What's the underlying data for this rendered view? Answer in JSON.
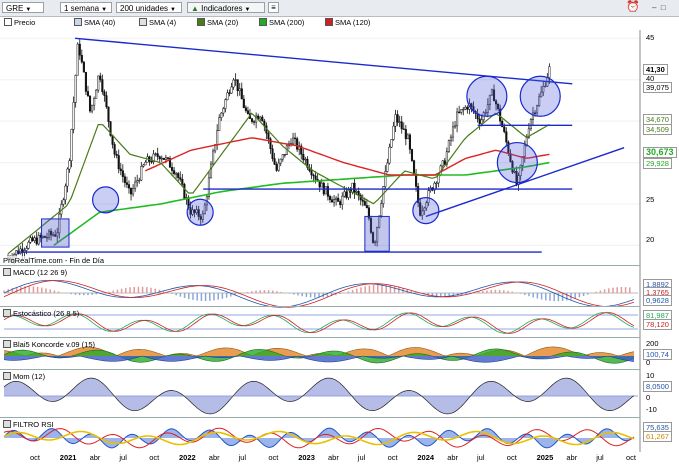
{
  "toolbar": {
    "ticker": "GRE",
    "period": "1 semana",
    "units": "200 unidades",
    "indicators_label": "Indicadores"
  },
  "legend": [
    {
      "label": "Precio",
      "color": "#ffffff"
    },
    {
      "label": "SMA (40)",
      "color": "#c8d8e8"
    },
    {
      "label": "SMA (4)",
      "color": "#e0e0e0"
    },
    {
      "label": "SMA (20)",
      "color": "#4a7a1a"
    },
    {
      "label": "SMA (200)",
      "color": "#22aa22"
    },
    {
      "label": "SMA (120)",
      "color": "#cc2222"
    }
  ],
  "watermark": "ProRealTime.com - Fin de Día",
  "price_axis": {
    "ticks": [
      "45",
      "40",
      "35",
      "30",
      "25",
      "20"
    ],
    "value_boxes": [
      {
        "label": "41,30",
        "color": "#000000"
      },
      {
        "label": "39,075",
        "color": "#000000"
      },
      {
        "label": "34,670",
        "color": "#4a7a1a"
      },
      {
        "label": "34,509",
        "color": "#4a7a1a"
      },
      {
        "label": "30,673",
        "color": "#22aa22"
      },
      {
        "label": "29,928",
        "color": "#22aa22"
      }
    ]
  },
  "panels": {
    "macd": {
      "title": "MACD (12 26 9)",
      "values": [
        "1,8892",
        "1,3765",
        "0,9628"
      ]
    },
    "stoch": {
      "title": "Estocástico (26 8 5)",
      "values": [
        "81,987",
        "78,120"
      ]
    },
    "koncorde": {
      "title": "Blai5 Koncorde v.09 (15)",
      "ticks": [
        "200",
        "100",
        "0"
      ],
      "values": [
        "100,74"
      ]
    },
    "mom": {
      "title": "Mom (12)",
      "ticks": [
        "10",
        "0",
        "-10"
      ],
      "values": [
        "8,0500"
      ]
    },
    "rsi": {
      "title": "FILTRO RSI",
      "values": [
        "75,635",
        "61,267"
      ]
    }
  },
  "x_axis": [
    {
      "label": "oct",
      "year": false
    },
    {
      "label": "2021",
      "year": true
    },
    {
      "label": "abr",
      "year": false
    },
    {
      "label": "jul",
      "year": false
    },
    {
      "label": "oct",
      "year": false
    },
    {
      "label": "2022",
      "year": true
    },
    {
      "label": "abr",
      "year": false
    },
    {
      "label": "jul",
      "year": false
    },
    {
      "label": "oct",
      "year": false
    },
    {
      "label": "2023",
      "year": true
    },
    {
      "label": "abr",
      "year": false
    },
    {
      "label": "jul",
      "year": false
    },
    {
      "label": "oct",
      "year": false
    },
    {
      "label": "2024",
      "year": true
    },
    {
      "label": "abr",
      "year": false
    },
    {
      "label": "jul",
      "year": false
    },
    {
      "label": "oct",
      "year": false
    },
    {
      "label": "2025",
      "year": true
    },
    {
      "label": "abr",
      "year": false
    },
    {
      "label": "jul",
      "year": false
    },
    {
      "label": "oct",
      "year": false
    }
  ],
  "chart_data": {
    "type": "line",
    "title": "",
    "ylim": [
      18,
      46
    ],
    "price_anchors": [
      {
        "x": 0.0,
        "y": 18.5
      },
      {
        "x": 0.8,
        "y": 20.5
      },
      {
        "x": 1.6,
        "y": 21.5
      },
      {
        "x": 2.0,
        "y": 30
      },
      {
        "x": 2.3,
        "y": 44.5
      },
      {
        "x": 2.7,
        "y": 36
      },
      {
        "x": 3.0,
        "y": 41
      },
      {
        "x": 3.5,
        "y": 31
      },
      {
        "x": 4.0,
        "y": 26
      },
      {
        "x": 4.5,
        "y": 30
      },
      {
        "x": 5.0,
        "y": 31
      },
      {
        "x": 5.5,
        "y": 29
      },
      {
        "x": 6.0,
        "y": 24
      },
      {
        "x": 6.4,
        "y": 23.5
      },
      {
        "x": 6.9,
        "y": 35
      },
      {
        "x": 7.4,
        "y": 40.5
      },
      {
        "x": 7.9,
        "y": 35
      },
      {
        "x": 8.3,
        "y": 36
      },
      {
        "x": 8.8,
        "y": 29
      },
      {
        "x": 9.3,
        "y": 33
      },
      {
        "x": 9.8,
        "y": 30
      },
      {
        "x": 10.3,
        "y": 27
      },
      {
        "x": 10.8,
        "y": 25
      },
      {
        "x": 11.3,
        "y": 27
      },
      {
        "x": 11.8,
        "y": 24
      },
      {
        "x": 12.0,
        "y": 20
      },
      {
        "x": 12.3,
        "y": 27
      },
      {
        "x": 12.7,
        "y": 35.5
      },
      {
        "x": 13.1,
        "y": 33
      },
      {
        "x": 13.5,
        "y": 24
      },
      {
        "x": 13.9,
        "y": 27
      },
      {
        "x": 14.3,
        "y": 30
      },
      {
        "x": 14.7,
        "y": 35.5
      },
      {
        "x": 15.1,
        "y": 37
      },
      {
        "x": 15.5,
        "y": 35
      },
      {
        "x": 15.9,
        "y": 38.5
      },
      {
        "x": 16.3,
        "y": 33
      },
      {
        "x": 16.7,
        "y": 27
      },
      {
        "x": 17.1,
        "y": 35
      },
      {
        "x": 17.5,
        "y": 38.5
      },
      {
        "x": 17.75,
        "y": 41.3
      }
    ],
    "sma20_anchors": [
      {
        "x": 0,
        "y": 19
      },
      {
        "x": 2,
        "y": 25
      },
      {
        "x": 3,
        "y": 35
      },
      {
        "x": 4,
        "y": 31
      },
      {
        "x": 5,
        "y": 30
      },
      {
        "x": 6,
        "y": 26
      },
      {
        "x": 7,
        "y": 31
      },
      {
        "x": 8,
        "y": 36
      },
      {
        "x": 9,
        "y": 32
      },
      {
        "x": 10,
        "y": 29
      },
      {
        "x": 11,
        "y": 27
      },
      {
        "x": 12,
        "y": 25
      },
      {
        "x": 13,
        "y": 29
      },
      {
        "x": 14,
        "y": 28
      },
      {
        "x": 15,
        "y": 33
      },
      {
        "x": 16,
        "y": 36
      },
      {
        "x": 17,
        "y": 33
      },
      {
        "x": 17.75,
        "y": 34.6
      }
    ],
    "sma120_anchors": [
      {
        "x": 4.5,
        "y": 29
      },
      {
        "x": 6,
        "y": 31.5
      },
      {
        "x": 8,
        "y": 33
      },
      {
        "x": 9.5,
        "y": 32
      },
      {
        "x": 11,
        "y": 30
      },
      {
        "x": 12.5,
        "y": 28.5
      },
      {
        "x": 14,
        "y": 28.5
      },
      {
        "x": 15,
        "y": 30.5
      },
      {
        "x": 16,
        "y": 31.5
      },
      {
        "x": 17,
        "y": 30.5
      },
      {
        "x": 17.75,
        "y": 31
      }
    ],
    "sma200_anchors": [
      {
        "x": 1.5,
        "y": 20
      },
      {
        "x": 3,
        "y": 24
      },
      {
        "x": 5,
        "y": 25
      },
      {
        "x": 7,
        "y": 26.5
      },
      {
        "x": 9,
        "y": 27.5
      },
      {
        "x": 11,
        "y": 28
      },
      {
        "x": 13,
        "y": 28.5
      },
      {
        "x": 15,
        "y": 28.5
      },
      {
        "x": 17,
        "y": 29.5
      },
      {
        "x": 17.75,
        "y": 30
      }
    ],
    "trendlines": [
      {
        "x1": 2.2,
        "y1": 45,
        "x2": 18.5,
        "y2": 39.5
      },
      {
        "x1": 6.4,
        "y1": 26.8,
        "x2": 18.5,
        "y2": 26.8
      },
      {
        "x1": 0.3,
        "y1": 19.2,
        "x2": 17.5,
        "y2": 19.2
      },
      {
        "x1": 15.4,
        "y1": 34.5,
        "x2": 18.5,
        "y2": 34.5
      },
      {
        "x1": 13.7,
        "y1": 23.5,
        "x2": 20.2,
        "y2": 31.8
      }
    ],
    "circles": [
      {
        "x": 3.2,
        "y": 25.5
      },
      {
        "x": 6.3,
        "y": 24
      },
      {
        "x": 13.7,
        "y": 24.2
      },
      {
        "x": 15.7,
        "y": 38
      },
      {
        "x": 16.7,
        "y": 30
      },
      {
        "x": 17.45,
        "y": 38
      }
    ],
    "boxes": [
      {
        "x1": 1.1,
        "y1": 19.8,
        "x2": 2.0,
        "y2": 23.2
      },
      {
        "x1": 11.7,
        "y1": 19.3,
        "x2": 12.5,
        "y2": 23.5
      }
    ]
  }
}
